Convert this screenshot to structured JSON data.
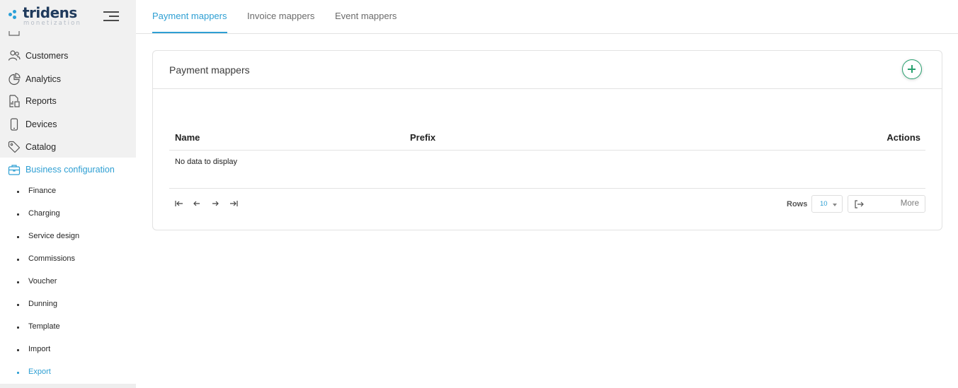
{
  "brand": {
    "name": "tridens",
    "tagline": "monetization"
  },
  "sidebar": {
    "items": [
      {
        "label": "Customers",
        "icon": "users-icon"
      },
      {
        "label": "Analytics",
        "icon": "pie-chart-icon"
      },
      {
        "label": "Reports",
        "icon": "report-icon"
      },
      {
        "label": "Devices",
        "icon": "smartphone-icon"
      },
      {
        "label": "Catalog",
        "icon": "tag-icon"
      },
      {
        "label": "Business configuration",
        "icon": "briefcase-icon",
        "active": true
      }
    ],
    "subitems": [
      {
        "label": "Finance"
      },
      {
        "label": "Charging"
      },
      {
        "label": "Service design"
      },
      {
        "label": "Commissions"
      },
      {
        "label": "Voucher"
      },
      {
        "label": "Dunning"
      },
      {
        "label": "Template"
      },
      {
        "label": "Import"
      },
      {
        "label": "Export",
        "active": true
      }
    ]
  },
  "tabs": [
    {
      "label": "Payment mappers",
      "active": true
    },
    {
      "label": "Invoice mappers"
    },
    {
      "label": "Event mappers"
    }
  ],
  "card": {
    "title": "Payment mappers",
    "table": {
      "columns": [
        "Name",
        "Prefix",
        "Actions"
      ],
      "empty_text": "No data to display"
    },
    "pagination": {
      "rows_label": "Rows",
      "rows_value": "10",
      "more_label": "More"
    }
  },
  "colors": {
    "accent": "#2e9fd3",
    "add_button": "#27a06e",
    "brand_text": "#1f3a5c"
  }
}
